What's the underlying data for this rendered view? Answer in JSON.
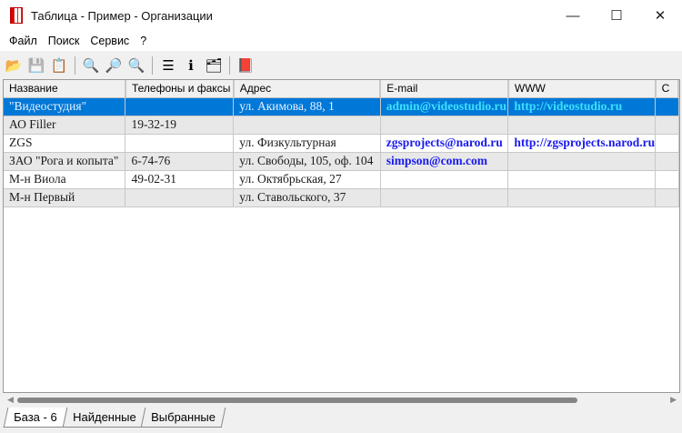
{
  "window": {
    "title": "Таблица - Пример - Организации",
    "minimize": "—",
    "maximize": "☐",
    "close": "✕"
  },
  "menu": [
    "Файл",
    "Поиск",
    "Сервис",
    "?"
  ],
  "toolbar": [
    {
      "icon": "open-folder-icon",
      "glyph": "📂"
    },
    {
      "icon": "save-icon",
      "glyph": "💾"
    },
    {
      "icon": "export-icon",
      "glyph": "📋"
    },
    {
      "icon": "zoom-info-icon",
      "glyph": "🔍"
    },
    {
      "icon": "search-icon",
      "glyph": "🔎"
    },
    {
      "icon": "zoom-add-icon",
      "glyph": "🔍"
    },
    {
      "icon": "sort-icon",
      "glyph": "☰"
    },
    {
      "icon": "info-icon",
      "glyph": "ℹ"
    },
    {
      "icon": "properties-icon",
      "glyph": "🗂"
    },
    {
      "icon": "help-book-icon",
      "glyph": "📕"
    }
  ],
  "columns": [
    "Название",
    "Телефоны и факсы",
    "Адрес",
    "E-mail",
    "WWW",
    "С"
  ],
  "rows": [
    [
      "\"Видеостудия\"",
      "",
      "ул. Акимова, 88, 1",
      "admin@videostudio.ru",
      "http://videostudio.ru",
      ""
    ],
    [
      "АО Filler",
      "19-32-19",
      "",
      "",
      "",
      ""
    ],
    [
      "ZGS",
      "",
      "ул. Физкультурная",
      "zgsprojects@narod.ru",
      "http://zgsprojects.narod.ru",
      ""
    ],
    [
      "ЗАО \"Рога и копыта\"",
      "6-74-76",
      "ул. Свободы, 105, оф. 104",
      "simpson@com.com",
      "",
      ""
    ],
    [
      "М-н Виола",
      "49-02-31",
      "ул. Октябрьская, 27",
      "",
      "",
      ""
    ],
    [
      "М-н Первый",
      "",
      "ул. Ставольского, 37",
      "",
      "",
      ""
    ]
  ],
  "selected_row": 0,
  "tabs": [
    "База - 6",
    "Найденные",
    "Выбранные"
  ]
}
